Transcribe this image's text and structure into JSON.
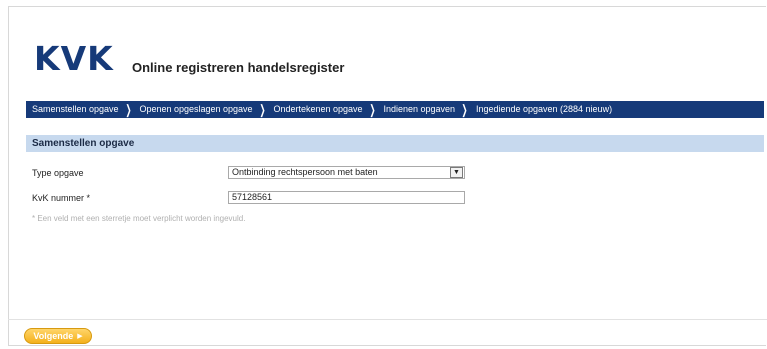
{
  "header": {
    "logo_text": "KVK",
    "title": "Online registreren handelsregister"
  },
  "nav": {
    "items": [
      {
        "label": "Samenstellen opgave"
      },
      {
        "label": "Openen opgeslagen opgave"
      },
      {
        "label": "Ondertekenen opgave"
      },
      {
        "label": "Indienen opgaven"
      },
      {
        "label": "Ingediende opgaven (2884 nieuw)"
      }
    ]
  },
  "section": {
    "title": "Samenstellen opgave"
  },
  "form": {
    "type_label": "Type opgave",
    "type_value": "Ontbinding rechtspersoon met baten",
    "kvk_label": "KvK nummer *",
    "kvk_value": "57128561",
    "required_note": "* Een veld met een sterretje moet verplicht worden ingevuld."
  },
  "footer": {
    "next_label": "Volgende"
  },
  "colors": {
    "brand": "#163a79",
    "section_bg": "#c7d9ee",
    "button": "#f4b01c"
  }
}
